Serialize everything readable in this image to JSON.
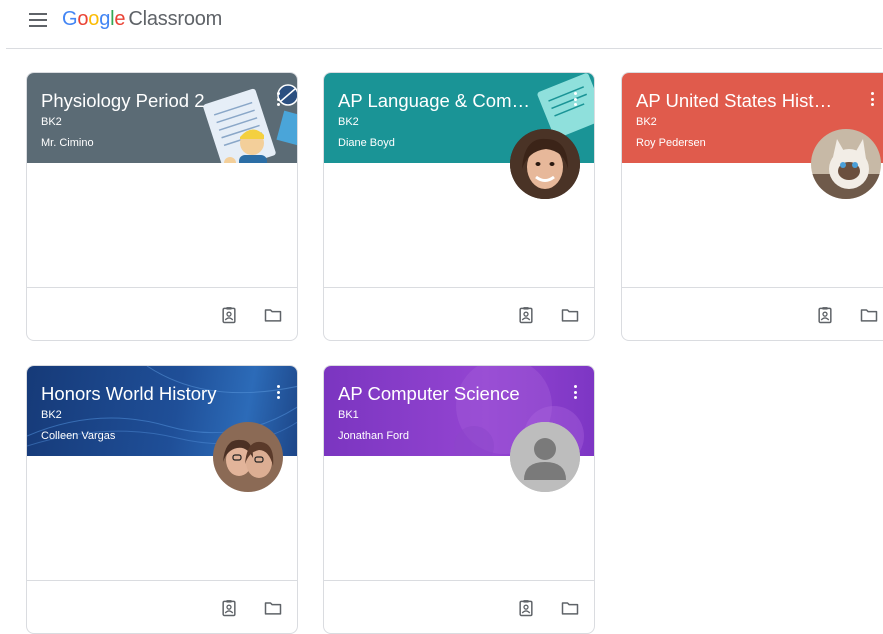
{
  "app": {
    "logo_letters": [
      "G",
      "o",
      "o",
      "g",
      "l",
      "e"
    ],
    "product": "Classroom"
  },
  "colors": {
    "physiology": "#5b6b75",
    "ap_language": "#1a9496",
    "ap_us_history": "#e05b4c",
    "honors_world": "#1f4a8c",
    "ap_cs": "#8a3ec7"
  },
  "cards": [
    {
      "title": "Physiology Period 2",
      "section": "BK2",
      "teacher": "Mr. Cimino",
      "theme": "physiology",
      "avatar": "illustration"
    },
    {
      "title": "AP Language & Composition",
      "section": "BK2",
      "teacher": "Diane Boyd",
      "theme": "ap_language",
      "avatar": "photo"
    },
    {
      "title": "AP United States History",
      "section": "BK2",
      "teacher": "Roy Pedersen",
      "theme": "ap_us_history",
      "avatar": "cat-photo"
    },
    {
      "title": "Honors World History",
      "section": "BK2",
      "teacher": "Colleen Vargas",
      "theme": "honors_world",
      "avatar": "photo"
    },
    {
      "title": "AP Computer Science",
      "section": "BK1",
      "teacher": "Jonathan Ford",
      "theme": "ap_cs",
      "avatar": "default-person-icon"
    }
  ],
  "footer_icons": [
    "your-work-icon",
    "folder-icon"
  ]
}
